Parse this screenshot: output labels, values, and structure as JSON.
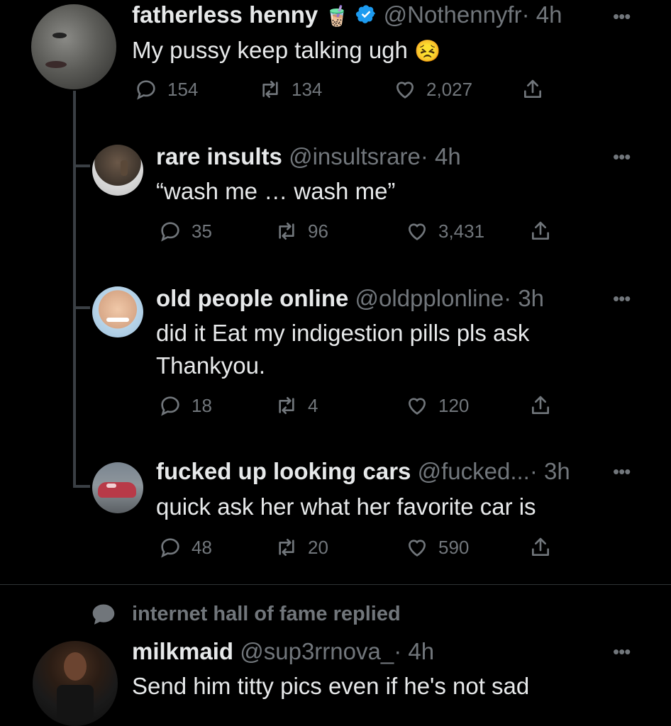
{
  "tweets": [
    {
      "name": "fatherless henny",
      "name_emoji": "🧋",
      "handle": "@Nothennyfr",
      "time": "· 4h",
      "text": "My pussy keep talking ugh",
      "text_emoji": "😣",
      "replies": "154",
      "retweets": "134",
      "likes": "2,027",
      "verified": true
    },
    {
      "name": "rare insults",
      "handle": "@insultsrare",
      "time": "· 4h",
      "text": "“wash me … wash me”",
      "replies": "35",
      "retweets": "96",
      "likes": "3,431"
    },
    {
      "name": "old people online",
      "handle": "@oldpplonline",
      "time": "· 3h",
      "text_line1": "did it Eat my indigestion pills pls ask",
      "text_line2": "Thankyou.",
      "replies": "18",
      "retweets": "4",
      "likes": "120"
    },
    {
      "name": "fucked up looking cars",
      "handle": "@fucked...",
      "time": "· 3h",
      "text": "quick ask her what her favorite car is",
      "replies": "48",
      "retweets": "20",
      "likes": "590"
    }
  ],
  "social_context": "internet hall of fame replied",
  "reply_tweet": {
    "name": "milkmaid",
    "handle": "@sup3rrnova_",
    "time": "· 4h",
    "text": "Send him titty pics even if he's not sad"
  },
  "colors": {
    "background": "#000000",
    "primary_text": "#e7e9ea",
    "secondary_text": "#71767b",
    "verified_blue": "#1d9bf0"
  },
  "icons": [
    "reply-icon",
    "retweet-icon",
    "like-icon",
    "share-icon",
    "more-icon",
    "verified-badge-icon",
    "speech-bubble-icon"
  ]
}
